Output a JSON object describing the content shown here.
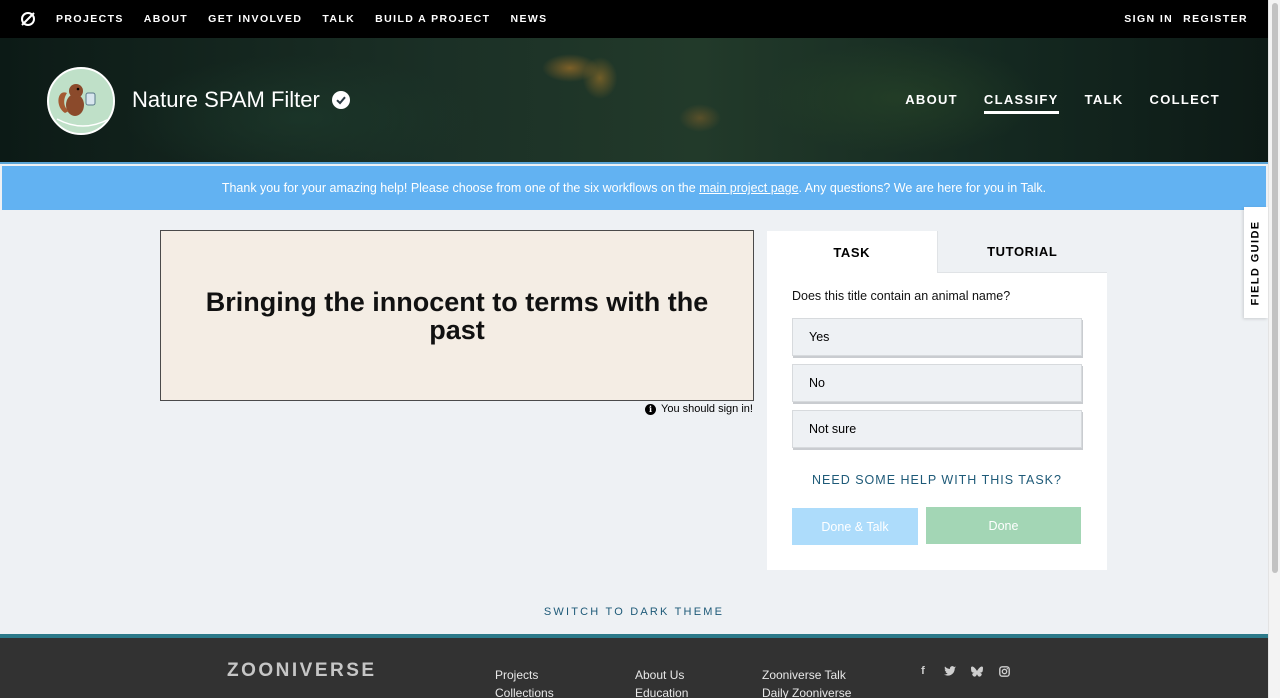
{
  "topnav": {
    "links": [
      "PROJECTS",
      "ABOUT",
      "GET INVOLVED",
      "TALK",
      "BUILD A PROJECT",
      "NEWS"
    ],
    "sign_in": "SIGN IN",
    "register": "REGISTER"
  },
  "project": {
    "title": "Nature SPAM Filter",
    "nav": [
      "ABOUT",
      "CLASSIFY",
      "TALK",
      "COLLECT"
    ],
    "active_nav": "CLASSIFY"
  },
  "announcement": {
    "before": "Thank you for your amazing help! Please choose from one of the six workflows on the ",
    "link": "main project page",
    "after": ". Any questions? We are here for you in Talk."
  },
  "subject": {
    "text": "Bringing the innocent to terms with the past",
    "sign_in_note": "You should sign in!"
  },
  "task_panel": {
    "tab_task": "TASK",
    "tab_tutorial": "TUTORIAL",
    "question": "Does this title contain an animal name?",
    "answers": [
      "Yes",
      "No",
      "Not sure"
    ],
    "help": "NEED SOME HELP WITH THIS TASK?",
    "done_talk": "Done & Talk",
    "done": "Done"
  },
  "field_guide": "FIELD GUIDE",
  "theme_switch": "SWITCH TO DARK THEME",
  "footer": {
    "brand": "ZOONIVERSE",
    "col1": [
      "Projects",
      "Collections"
    ],
    "col2": [
      "About Us",
      "Education"
    ],
    "col3": [
      "Zooniverse Talk",
      "Daily Zooniverse"
    ],
    "social_icons": [
      "facebook-icon",
      "twitter-icon",
      "bluesky-icon",
      "instagram-icon"
    ]
  },
  "colors": {
    "announcement_bg": "#62b2f2",
    "done_talk_bg": "#addcfb",
    "done_bg": "#a3d6b5",
    "subject_bg": "#f4ede4",
    "footer_bg": "#323232",
    "accent_teal": "#1e5a78"
  }
}
